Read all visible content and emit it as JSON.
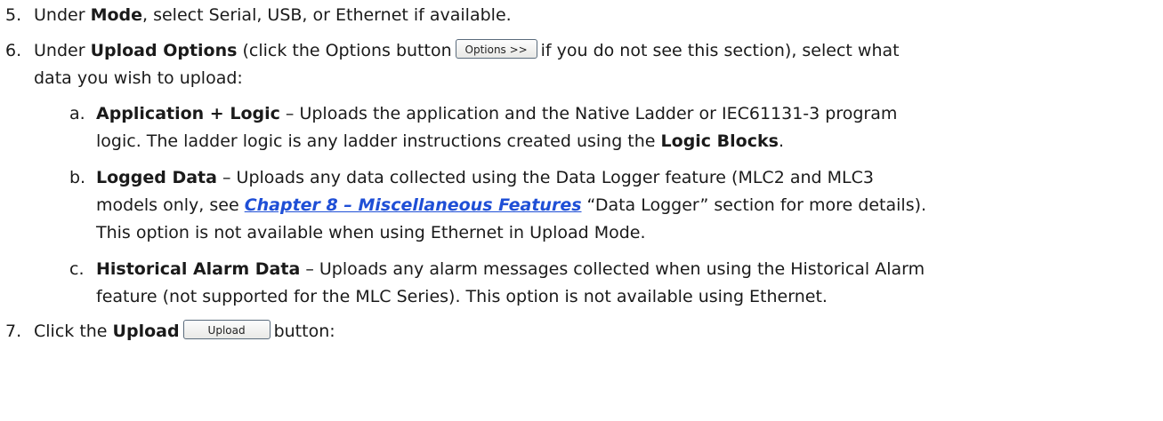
{
  "step5": {
    "number": "5.",
    "t1": "Under ",
    "b1": "Mode",
    "t2": ", select Serial, USB, or Ethernet if available."
  },
  "step6": {
    "number": "6.",
    "t1": "Under ",
    "b1": "Upload Options",
    "t2": " (click the Options button",
    "button_label": "Options >>",
    "t3": "if you do not see this section), select what",
    "t4": "data you wish to upload:"
  },
  "item_a": {
    "letter": "a.",
    "b1": "Application + Logic",
    "t1": " – Uploads the application and the Native Ladder or IEC61131-3 program",
    "t2": "logic. The ladder logic is any ladder instructions created using the ",
    "b2": "Logic Blocks",
    "t3": "."
  },
  "item_b": {
    "letter": "b.",
    "b1": "Logged Data",
    "t1": " – Uploads any data collected using the Data Logger feature (MLC2 and MLC3",
    "t2": "models only, see ",
    "link": "Chapter 8 – Miscellaneous Features",
    "t3": " “Data Logger” section for more details).",
    "t4": "This option is not available when using Ethernet in Upload Mode."
  },
  "item_c": {
    "letter": "c.",
    "b1": "Historical Alarm Data",
    "t1": " – Uploads any alarm messages collected when using the Historical Alarm",
    "t2": "feature (not supported for the MLC Series). This option is not available using Ethernet."
  },
  "step7": {
    "number": "7.",
    "t1": "Click the ",
    "b1": "Upload",
    "button_label": "Upload",
    "t2": "button:"
  }
}
